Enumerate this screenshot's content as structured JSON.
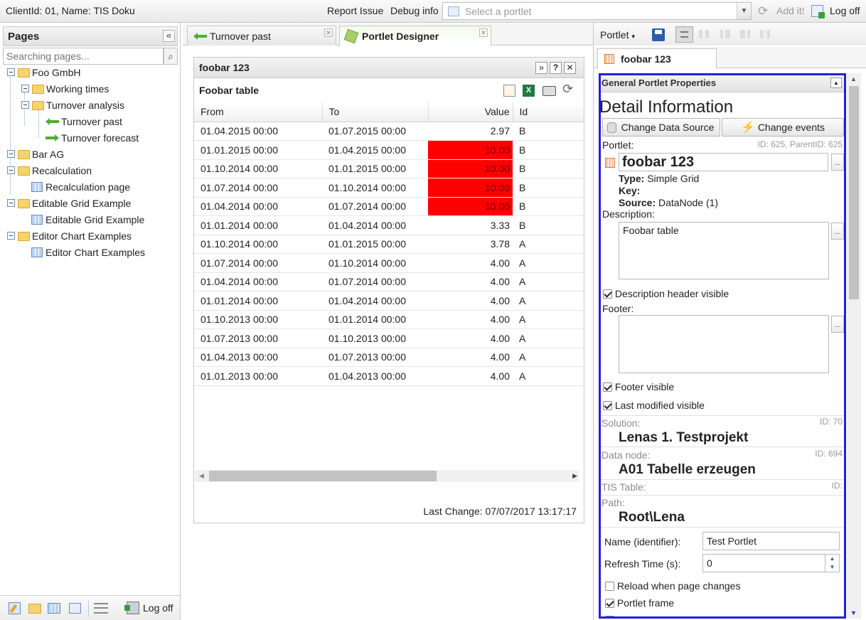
{
  "topbar": {
    "client_info": "ClientId: 01, Name: TIS Doku",
    "report_issue": "Report Issue",
    "debug_info": "Debug info",
    "portlet_select_placeholder": "Select a portlet",
    "add_it": "Add it!",
    "log_off": "Log off"
  },
  "pages": {
    "title": "Pages",
    "search_placeholder": "Searching pages...",
    "tree": [
      {
        "label": "Foo GmbH"
      },
      {
        "label": "Working times"
      },
      {
        "label": "Turnover analysis"
      },
      {
        "label": "Turnover past"
      },
      {
        "label": "Turnover forecast"
      },
      {
        "label": "Bar AG"
      },
      {
        "label": "Recalculation"
      },
      {
        "label": "Recalculation page"
      },
      {
        "label": "Editable Grid Example"
      },
      {
        "label": "Editable Grid Example"
      },
      {
        "label": "Editor Chart Examples"
      },
      {
        "label": "Editor Chart Examples"
      }
    ],
    "footer_log_off": "Log off"
  },
  "tabs": [
    {
      "label": "Turnover past"
    },
    {
      "label": "Portlet Designer"
    }
  ],
  "portlet": {
    "title": "foobar 123",
    "table_title": "Foobar table",
    "columns": [
      "From",
      "To",
      "Value",
      "Id"
    ],
    "rows": [
      {
        "from": "01.04.2015 00:00",
        "to": "01.07.2015 00:00",
        "value": "2.97",
        "id": "B"
      },
      {
        "from": "01.01.2015 00:00",
        "to": "01.04.2015 00:00",
        "value": "10.00",
        "id": "B"
      },
      {
        "from": "01.10.2014 00:00",
        "to": "01.01.2015 00:00",
        "value": "10.00",
        "id": "B"
      },
      {
        "from": "01.07.2014 00:00",
        "to": "01.10.2014 00:00",
        "value": "10.00",
        "id": "B"
      },
      {
        "from": "01.04.2014 00:00",
        "to": "01.07.2014 00:00",
        "value": "10.00",
        "id": "B"
      },
      {
        "from": "01.01.2014 00:00",
        "to": "01.04.2014 00:00",
        "value": "3.33",
        "id": "B"
      },
      {
        "from": "01.10.2014 00:00",
        "to": "01.01.2015 00:00",
        "value": "3.78",
        "id": "A"
      },
      {
        "from": "01.07.2014 00:00",
        "to": "01.10.2014 00:00",
        "value": "4.00",
        "id": "A"
      },
      {
        "from": "01.04.2014 00:00",
        "to": "01.07.2014 00:00",
        "value": "4.00",
        "id": "A"
      },
      {
        "from": "01.01.2014 00:00",
        "to": "01.04.2014 00:00",
        "value": "4.00",
        "id": "A"
      },
      {
        "from": "01.10.2013 00:00",
        "to": "01.01.2014 00:00",
        "value": "4.00",
        "id": "A"
      },
      {
        "from": "01.07.2013 00:00",
        "to": "01.10.2013 00:00",
        "value": "4.00",
        "id": "A"
      },
      {
        "from": "01.04.2013 00:00",
        "to": "01.07.2013 00:00",
        "value": "4.00",
        "id": "A"
      },
      {
        "from": "01.01.2013 00:00",
        "to": "01.04.2013 00:00",
        "value": "4.00",
        "id": "A"
      }
    ],
    "highlight_color": "#ff0000",
    "last_change": "Last Change: 07/07/2017 13:17:17"
  },
  "designer": {
    "portlet_menu": "Portlet",
    "tab": "foobar 123",
    "section_title": "General Portlet Properties",
    "detail_title": "Detail Information",
    "change_data_source": "Change Data Source",
    "change_events": "Change events",
    "portlet_label": "Portlet:",
    "portlet_ids": "ID: 625, ParentID: 625",
    "portlet_name": "foobar 123",
    "type_label": "Type:",
    "type_value": "Simple Grid",
    "key_label": "Key:",
    "source_label": "Source:",
    "source_value": "DataNode (1)",
    "description_label": "Description:",
    "description_value": "Foobar table",
    "description_header_visible": "Description header visible",
    "footer_label": "Footer:",
    "footer_visible": "Footer visible",
    "last_modified_visible": "Last modified visible",
    "solution_label": "Solution:",
    "solution_id": "ID: 70",
    "solution_value": "Lenas 1. Testprojekt",
    "data_node_label": "Data node:",
    "data_node_id": "ID: 694",
    "data_node_value": "A01 Tabelle erzeugen",
    "tis_table_label": "TIS Table:",
    "tis_table_id": "ID:",
    "path_label": "Path:",
    "path_value": "Root\\Lena",
    "name_label": "Name (identifier):",
    "name_value": "Test Portlet",
    "refresh_label": "Refresh Time (s):",
    "refresh_value": "0",
    "reload_when_page_changes": "Reload when page changes",
    "portlet_frame": "Portlet frame",
    "highlight_border_color": "#2020dd"
  }
}
